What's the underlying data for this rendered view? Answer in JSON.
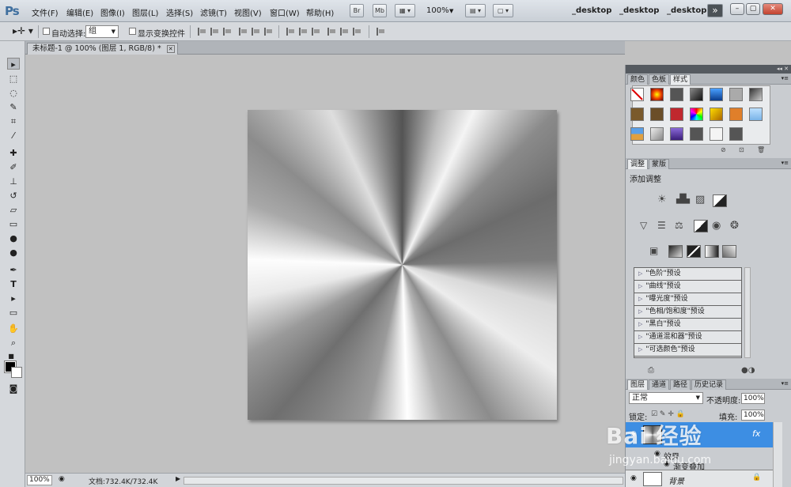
{
  "app": {
    "logo": "Ps"
  },
  "menu": [
    "文件(F)",
    "编辑(E)",
    "图像(I)",
    "图层(L)",
    "选择(S)",
    "滤镜(T)",
    "视图(V)",
    "窗口(W)",
    "帮助(H)"
  ],
  "topbar": {
    "br": "Br",
    "mb": "Mb",
    "zoom": "100%",
    "workspaces": [
      "_desktop",
      "_desktop",
      "_desktop"
    ],
    "more": "»"
  },
  "options": {
    "auto_select": "自动选择:",
    "auto_select_value": "组",
    "show_transform": "显示变换控件"
  },
  "document": {
    "tab": "未标题-1 @ 100% (图层 1, RGB/8) *",
    "zoom": "100%",
    "info": "文档:732.4K/732.4K"
  },
  "panels": {
    "color_tabs": [
      "颜色",
      "色板",
      "样式"
    ],
    "adjust_tabs": [
      "调整",
      "蒙版"
    ],
    "add_adjustment": "添加调整",
    "presets": [
      "\"色阶\"预设",
      "\"曲线\"预设",
      "\"曝光度\"预设",
      "\"色相/饱和度\"预设",
      "\"黑白\"预设",
      "\"通道混和器\"预设",
      "\"可选颜色\"预设"
    ],
    "layer_tabs": [
      "图层",
      "通道",
      "路径",
      "历史记录"
    ],
    "blend_mode": "正常",
    "opacity_label": "不透明度:",
    "opacity_value": "100%",
    "lock_label": "锁定:",
    "fill_label": "填充:",
    "fill_value": "100%",
    "fx": "fx",
    "effects_label": "效果",
    "effect_item": "渐变叠加",
    "background_layer": "背景"
  },
  "watermark": {
    "brand": "Bai 经验",
    "url": "jingyan.baidu.com"
  }
}
